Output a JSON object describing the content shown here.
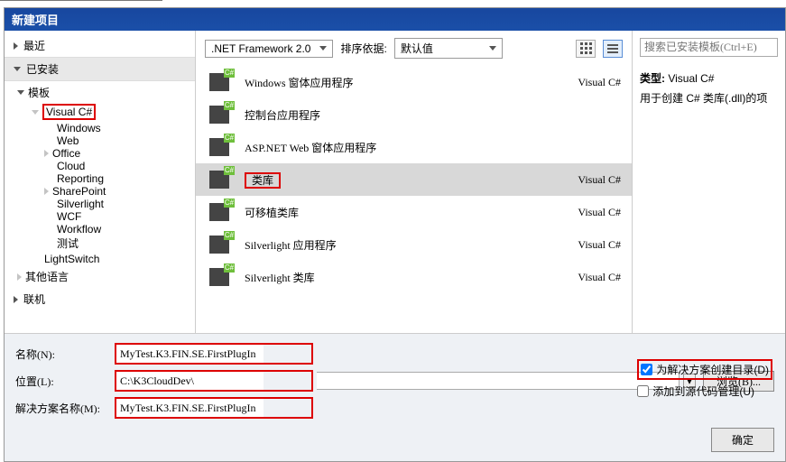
{
  "title": "新建项目",
  "sidebar": {
    "recent": "最近",
    "installed": "已安装",
    "templates": "模板",
    "vcs": "Visual C#",
    "children": [
      "Windows",
      "Web",
      "Office",
      "Cloud",
      "Reporting",
      "SharePoint",
      "Silverlight",
      "WCF",
      "Workflow",
      "测试"
    ],
    "lightswitch": "LightSwitch",
    "otherlang": "其他语言",
    "online": "联机"
  },
  "toolbar": {
    "framework": ".NET Framework 2.0",
    "sortlabel": "排序依据:",
    "sortval": "默认值"
  },
  "items": [
    {
      "label": "Windows 窗体应用程序",
      "lang": "Visual C#"
    },
    {
      "label": "控制台应用程序",
      "lang": ""
    },
    {
      "label": "ASP.NET Web 窗体应用程序",
      "lang": ""
    },
    {
      "label": "类库",
      "lang": "Visual C#"
    },
    {
      "label": "可移植类库",
      "lang": "Visual C#"
    },
    {
      "label": "Silverlight 应用程序",
      "lang": "Visual C#"
    },
    {
      "label": "Silverlight 类库",
      "lang": "Visual C#"
    }
  ],
  "right": {
    "search_ph": "搜索已安装模板(Ctrl+E)",
    "type_label": "类型:",
    "type_val": "Visual C#",
    "desc": "用于创建 C# 类库(.dll)的项"
  },
  "footer": {
    "name_label": "名称(N):",
    "name_val": "MyTest.K3.FIN.SE.FirstPlugIn",
    "loc_label": "位置(L):",
    "loc_val": "C:\\K3CloudDev\\",
    "sln_label": "解决方案名称(M):",
    "sln_val": "MyTest.K3.FIN.SE.FirstPlugIn",
    "browse": "浏览(B)...",
    "mkdir": "为解决方案创建目录(D)",
    "scm": "添加到源代码管理(U)",
    "ok": "确定"
  }
}
